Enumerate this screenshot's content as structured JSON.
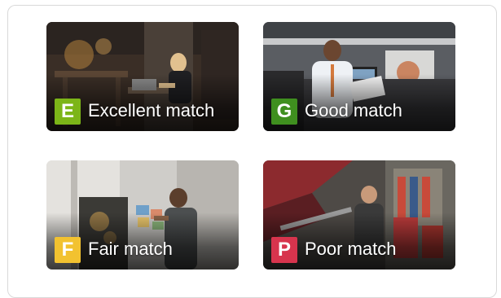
{
  "cards": [
    {
      "id": "excellent",
      "letter": "E",
      "label": "Excellent match",
      "badge_color": "#7cb518"
    },
    {
      "id": "good",
      "letter": "G",
      "label": "Good match",
      "badge_color": "#3f8f1f"
    },
    {
      "id": "fair",
      "letter": "F",
      "label": "Fair match",
      "badge_color": "#f2c230"
    },
    {
      "id": "poor",
      "letter": "P",
      "label": "Poor match",
      "badge_color": "#d7344d"
    }
  ],
  "icons": {
    "excellent": "photo-woman-on-phone-at-laptop",
    "good": "photo-man-reading-document-at-desk",
    "fair": "photo-man-at-whiteboard-with-notes",
    "poor": "photo-mechanic-in-auto-garage"
  }
}
